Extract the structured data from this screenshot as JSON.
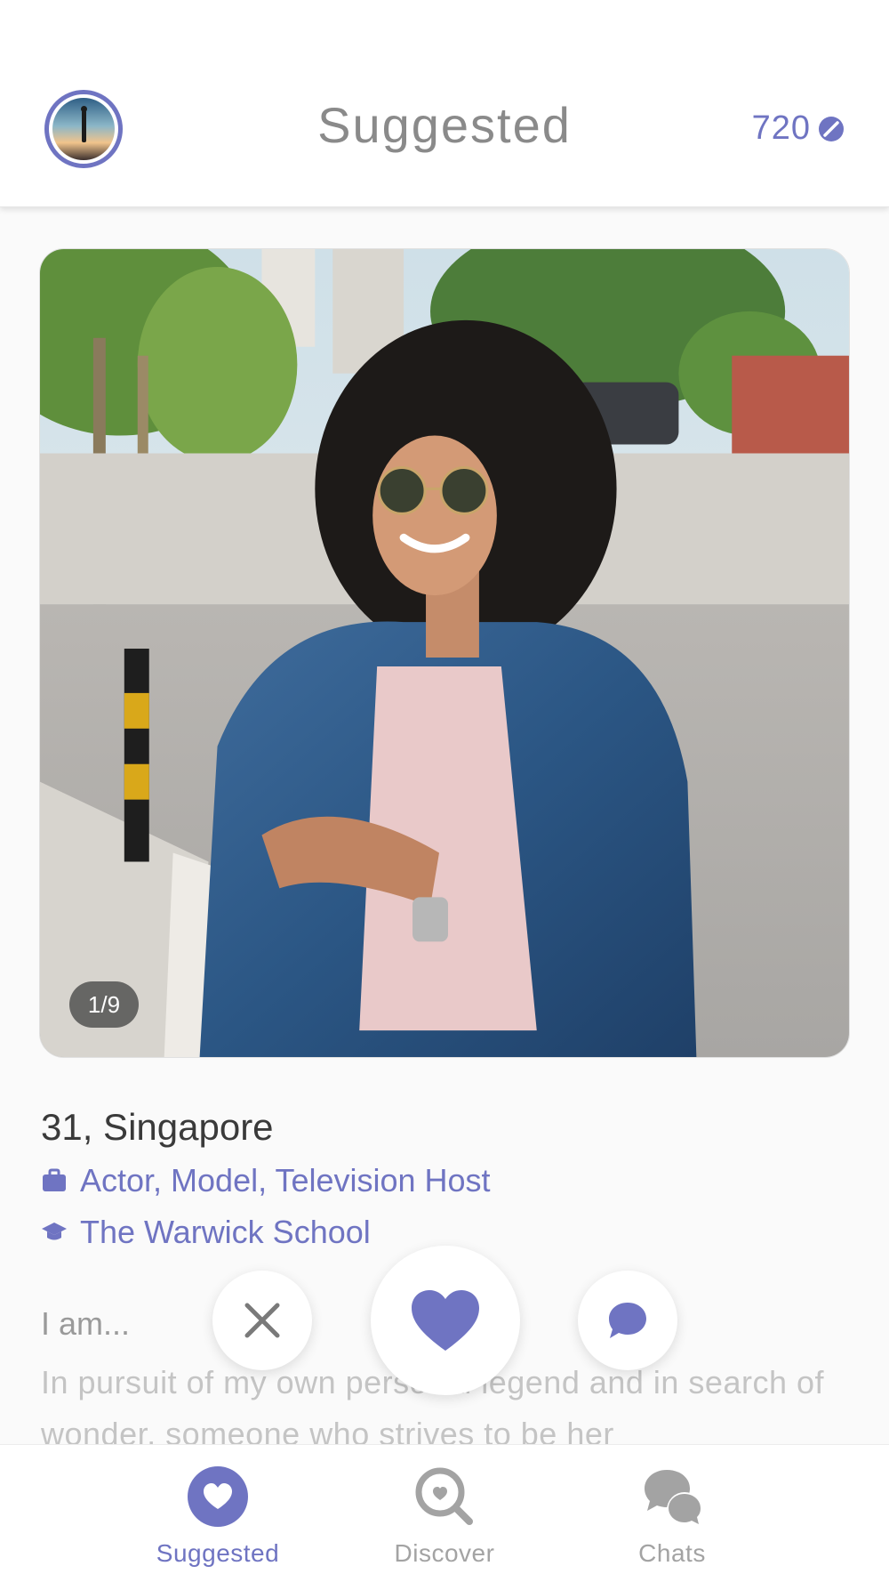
{
  "header": {
    "title": "Suggested",
    "coins": "720",
    "avatar_icon": "profile-avatar",
    "coin_icon": "coin-icon"
  },
  "profile": {
    "photo_counter": "1/9",
    "age_location": "31, Singapore",
    "occupation": "Actor, Model, Television Host",
    "school": "The Warwick School",
    "about_heading": "I am...",
    "about_text": "In pursuit of my own personal legend and in search of wonder, someone who strives to be her"
  },
  "actions": {
    "pass_icon": "close-icon",
    "like_icon": "heart-icon",
    "chat_icon": "chat-bubble-icon"
  },
  "tabs": [
    {
      "label": "Suggested",
      "icon": "heart-icon",
      "active": true
    },
    {
      "label": "Discover",
      "icon": "discover-icon",
      "active": false
    },
    {
      "label": "Chats",
      "icon": "chats-icon",
      "active": false
    }
  ],
  "colors": {
    "accent": "#6f74c2",
    "title_gray": "#8a8a8a",
    "inactive_gray": "#a3a3a3"
  }
}
